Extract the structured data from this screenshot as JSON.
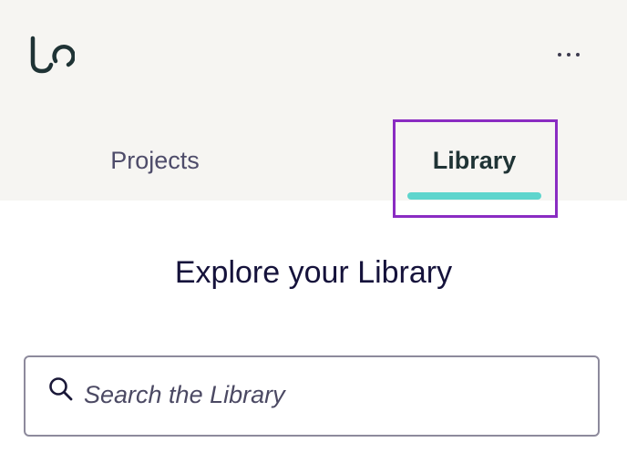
{
  "colors": {
    "header_bg": "#f6f5f2",
    "tab_underline": "#5ed5cd",
    "highlight_box": "#8a2cc2",
    "logo": "#1f3335"
  },
  "header": {
    "logo_icon": "lo-logo-icon",
    "more_icon": "more-horizontal-icon"
  },
  "tabs": [
    {
      "label": "Projects",
      "active": false
    },
    {
      "label": "Library",
      "active": true
    }
  ],
  "main": {
    "title": "Explore your Library"
  },
  "search": {
    "placeholder": "Search the Library",
    "value": "",
    "icon": "search-icon"
  }
}
